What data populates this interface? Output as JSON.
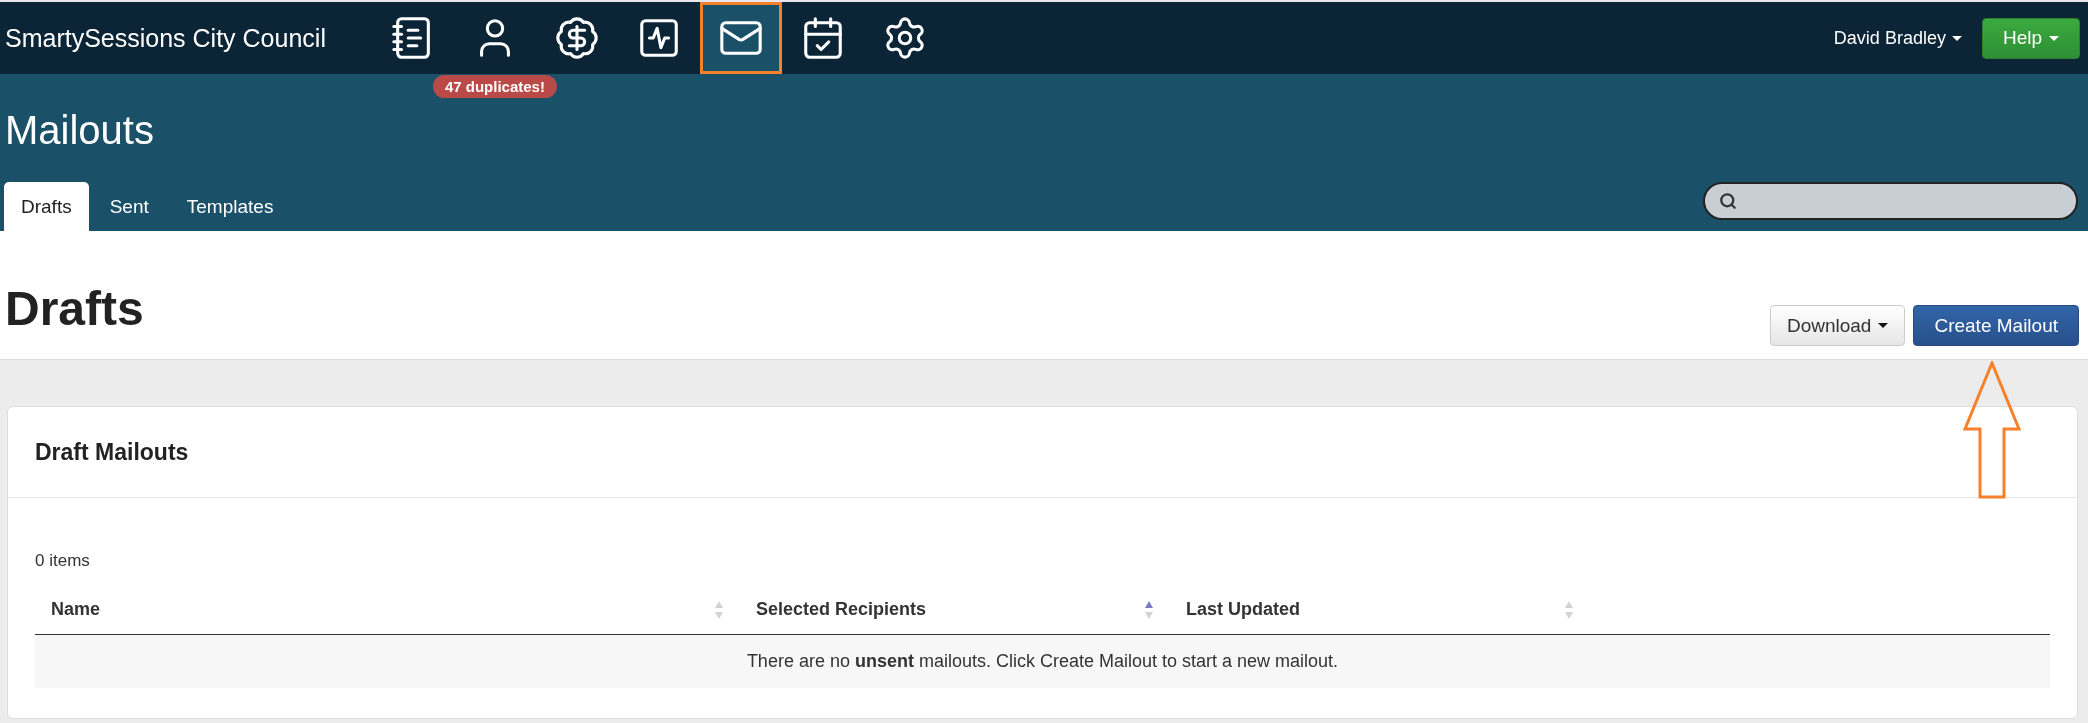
{
  "brand": "SmartySessions City Council",
  "nav_icons": [
    {
      "selected": false
    },
    {
      "selected": false,
      "badge": "47 duplicates!"
    },
    {
      "selected": false
    },
    {
      "selected": false
    },
    {
      "selected": true
    },
    {
      "selected": false
    },
    {
      "selected": false
    }
  ],
  "user_menu": "David Bradley",
  "help_button": "Help",
  "page_title": "Mailouts",
  "tabs": [
    {
      "label": "Drafts",
      "selected": true
    },
    {
      "label": "Sent",
      "selected": false
    },
    {
      "label": "Templates",
      "selected": false
    }
  ],
  "section_title": "Drafts",
  "download_button": "Download",
  "create_button": "Create Mailout",
  "annotation": {
    "kind": "up-arrow"
  },
  "card": {
    "title": "Draft Mailouts",
    "count": "0 items",
    "columns": [
      {
        "label": "Name",
        "sorted": false
      },
      {
        "label": "Selected Recipients",
        "sorted": true
      },
      {
        "label": "Last Updated",
        "sorted": false
      }
    ],
    "empty_message": "There are no **unsent** mailouts. Click Create Mailout to start a new mailout."
  }
}
